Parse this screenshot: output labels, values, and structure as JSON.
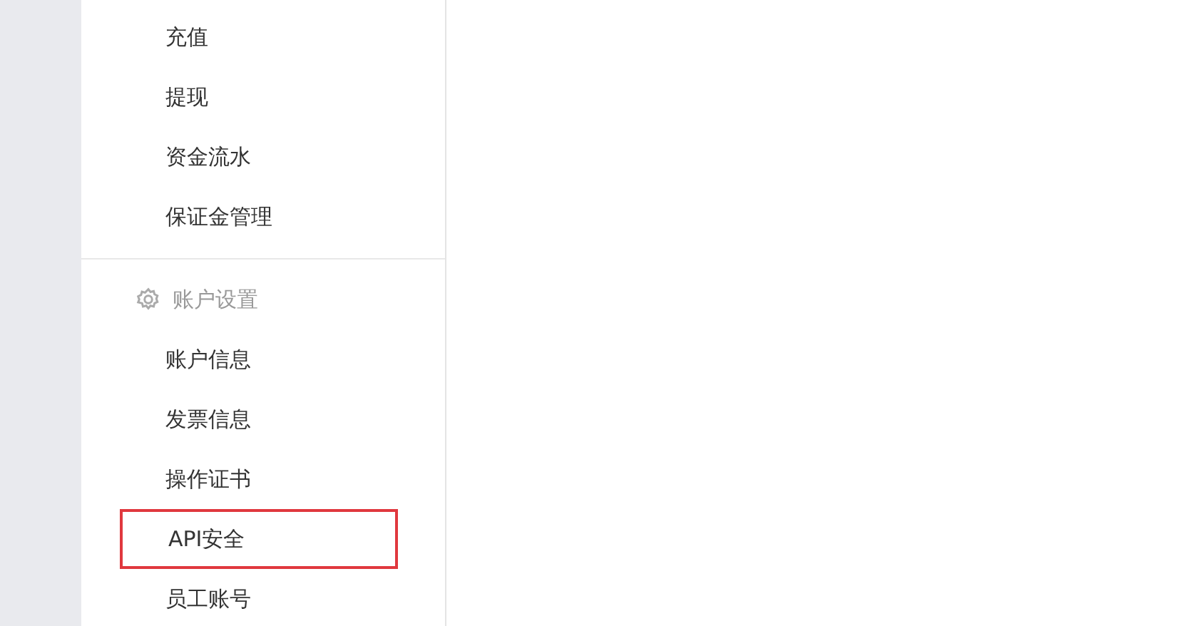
{
  "sidebar": {
    "groups": [
      {
        "items": [
          {
            "label": "充值",
            "highlighted": false
          },
          {
            "label": "提现",
            "highlighted": false
          },
          {
            "label": "资金流水",
            "highlighted": false
          },
          {
            "label": "保证金管理",
            "highlighted": false
          }
        ]
      },
      {
        "header": {
          "label": "账户设置"
        },
        "items": [
          {
            "label": "账户信息",
            "highlighted": false
          },
          {
            "label": "发票信息",
            "highlighted": false
          },
          {
            "label": "操作证书",
            "highlighted": false
          },
          {
            "label": "API安全",
            "highlighted": true
          },
          {
            "label": "员工账号",
            "highlighted": false
          }
        ]
      }
    ]
  }
}
